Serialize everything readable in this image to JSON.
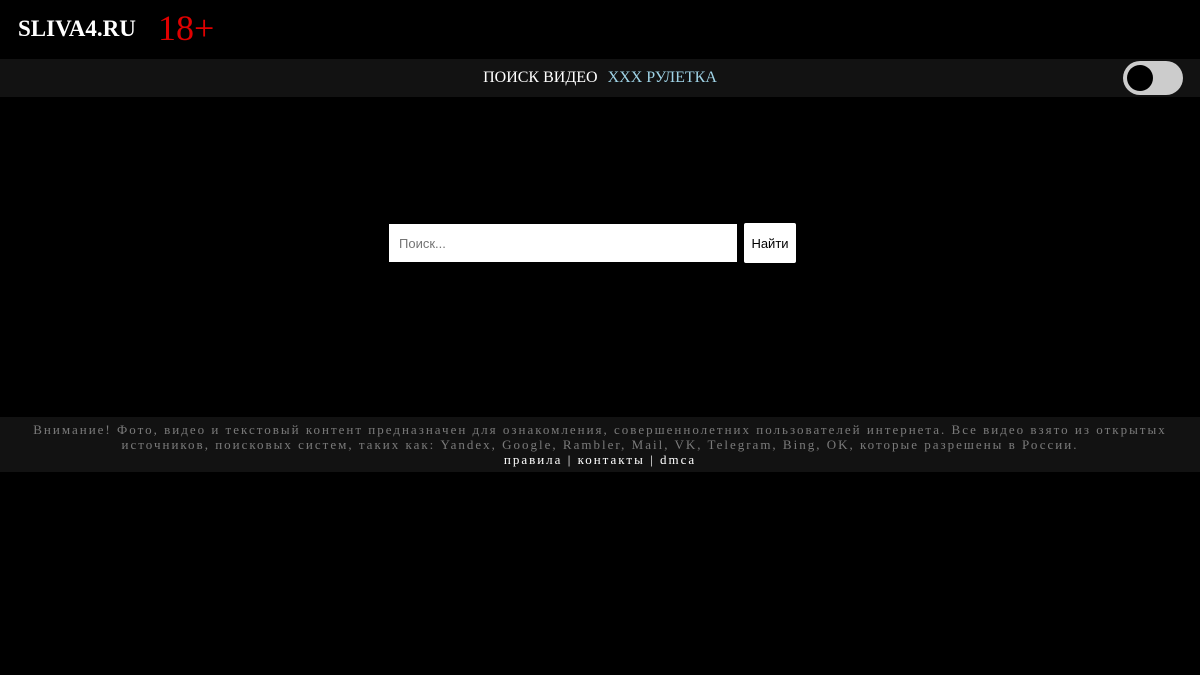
{
  "header": {
    "logo": "SLIVA4.RU",
    "age_badge": "18+"
  },
  "nav": {
    "items": [
      {
        "label": "ПОИСК ВИДЕО"
      },
      {
        "label": "XXX РУЛЕТКА"
      }
    ],
    "theme_toggle": {
      "state": "off"
    }
  },
  "search": {
    "placeholder": "Поиск...",
    "value": "",
    "button_label": "Найти"
  },
  "footer": {
    "disclaimer": "Внимание! Фото, видео и текстовый контент предназначен для ознакомления, совершеннолетних пользователей интернета. Все видео взято из открытых источников, поисковых систем, таких как: Yandex, Google, Rambler, Mail, VK, Telegram, Bing, OK, которые разрешены в России.",
    "links": [
      {
        "label": "правила"
      },
      {
        "label": "контакты"
      },
      {
        "label": "dmca"
      }
    ],
    "separator": "|"
  },
  "colors": {
    "background": "#000000",
    "bar": "#121212",
    "age_badge": "#e00000",
    "nav_accent": "#9fd3e6"
  }
}
